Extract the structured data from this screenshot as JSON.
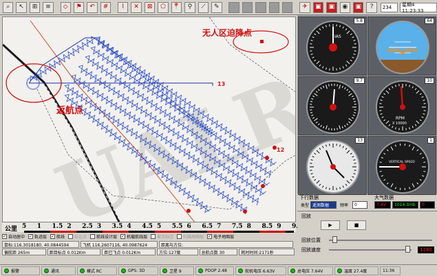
{
  "toolbar": {
    "counter": "234",
    "datetime": "星期4 11:23:33",
    "icons": [
      "zoom-icon",
      "pointer-icon",
      "measure-icon",
      "layer-icon",
      "waypoint-icon",
      "flag-icon",
      "undo-icon",
      "grid-icon",
      "route-icon",
      "cross-route-icon",
      "box-route-icon",
      "polygon-icon",
      "pin-icon",
      "microscope-icon",
      "ruler-icon",
      "pen-icon",
      "brush-icon",
      "gray-box-icon",
      "square-icon",
      "square-icon",
      "square-icon",
      "square-icon",
      "plane-icon",
      "tv-icon",
      "tv-icon",
      "camera-icon",
      "tv-icon",
      "help-icon"
    ]
  },
  "map": {
    "annotation_left": "返航点",
    "annotation_right": "无人区迫降点",
    "watermark": "UALR",
    "marker_13": "13",
    "marker_12": "12"
  },
  "scale": {
    "label": "公里",
    "ticks": [
      "5",
      "1",
      "1.5",
      "2",
      "2.5",
      "3",
      "3.5",
      "4",
      "4.5",
      "5",
      "5.5",
      "6",
      "6.5",
      "7",
      "7.5",
      "8",
      "8.5",
      "9",
      "9.5"
    ]
  },
  "checkboxes": [
    {
      "label": "自动居中",
      "checked": true,
      "disabled": false
    },
    {
      "label": "轨迹层",
      "checked": true,
      "disabled": false
    },
    {
      "label": "航线",
      "checked": true,
      "disabled": false
    },
    {
      "label": "标记点",
      "checked": false,
      "disabled": true
    },
    {
      "label": "航线设计层",
      "checked": false,
      "disabled": false
    },
    {
      "label": "机载航线层",
      "checked": true,
      "disabled": false
    },
    {
      "label": "显示标注",
      "checked": false,
      "disabled": true
    },
    {
      "label": "扫描地图层",
      "checked": false,
      "disabled": true
    },
    {
      "label": "电子地图层",
      "checked": true,
      "disabled": false
    }
  ],
  "info1": {
    "cursor": "鼠标:116.3018180, 40.0844594",
    "plane": "飞机 116.2607116, 40.0987624",
    "dist_heading": "距离与方位:"
  },
  "info2": {
    "offset": "偏航距 265m",
    "target_dist": "距目标点 0.012Km",
    "flown": "距已飞点 0.012Km",
    "heading": "方位:127度",
    "total": "总航点数 30",
    "time": "耗时时间:2171秒"
  },
  "gauges": {
    "values": [
      "5.8",
      "64",
      "9.7",
      "10",
      "13",
      "1"
    ],
    "speed_label": "IAS",
    "rpm_label": "RPM",
    "rpm_unit": "X 10000",
    "vs_label": "VERTICAL SPEED"
  },
  "downlink": {
    "title": "下行数据",
    "type_label": "类型",
    "type_value": "遥测数据",
    "rate_label": "频率",
    "rate_value": "0"
  },
  "atmosphere": {
    "title": "大气数据",
    "v1": "7.4V",
    "v2": "1014.3mb",
    "v3": "0"
  },
  "replay": {
    "title": "回放",
    "play": "▶",
    "stop": "■",
    "position_label": "回放位置",
    "speed_label": "回放速度",
    "speed_value": "1280",
    "position": 0.05,
    "speed": 0.95
  },
  "status": {
    "s1": "报警",
    "s2": "通讯",
    "s3": "模式 RC",
    "s4": "GPS: 3D",
    "s5": "卫星 9",
    "s6": "PDOP 2.48",
    "s7": "舵机电压 6.63V",
    "s8": "总电压 7.64V",
    "s9": "温度 27.4度",
    "s10": "11:36"
  },
  "colors": {
    "track": "#2a4fcf",
    "route": "#1a2fa0",
    "annotation": "#d01010",
    "watermark": "#b8b6b0"
  }
}
